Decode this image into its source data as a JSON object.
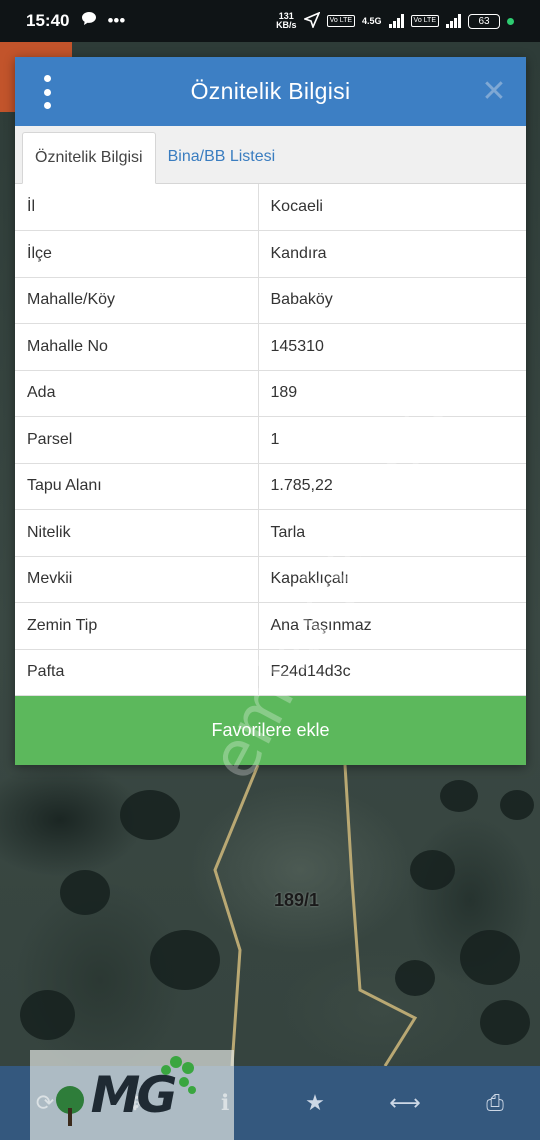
{
  "status_bar": {
    "time": "15:40",
    "speed_value": "131",
    "speed_unit": "KB/s",
    "network_label": "4.5G",
    "volte_label": "Vo LTE",
    "battery": "63"
  },
  "dialog": {
    "title": "Öznitelik Bilgisi",
    "tabs": [
      {
        "label": "Öznitelik Bilgisi",
        "active": true
      },
      {
        "label": "Bina/BB Listesi",
        "active": false
      }
    ],
    "rows": [
      {
        "key": "İl",
        "value": "Kocaeli"
      },
      {
        "key": "İlçe",
        "value": "Kandıra"
      },
      {
        "key": "Mahalle/Köy",
        "value": "Babaköy"
      },
      {
        "key": "Mahalle No",
        "value": "145310"
      },
      {
        "key": "Ada",
        "value": "189"
      },
      {
        "key": "Parsel",
        "value": "1"
      },
      {
        "key": "Tapu Alanı",
        "value": "1.785,22"
      },
      {
        "key": "Nitelik",
        "value": "Tarla"
      },
      {
        "key": "Mevkii",
        "value": "Kapaklıçalı"
      },
      {
        "key": "Zemin Tip",
        "value": "Ana Taşınmaz"
      },
      {
        "key": "Pafta",
        "value": "F24d14d3c"
      }
    ],
    "favorite_button": "Favorilere ekle"
  },
  "map": {
    "parcel_label": "189/1",
    "watermark": "emlakjet.com"
  },
  "bottom_bar": {
    "items": [
      "refresh-icon",
      "layers-icon",
      "info-icon",
      "star-icon",
      "measure-icon",
      "print-icon"
    ],
    "glyphs": [
      "⟳",
      "✥",
      "ℹ",
      "★",
      "⟷",
      "⎙"
    ]
  },
  "logo": {
    "text": "MG"
  },
  "colors": {
    "header_blue": "#3d7fc4",
    "favorite_green": "#5cb85c",
    "bottom_bar": "#34587e",
    "tab_link": "#3a7dc0"
  }
}
